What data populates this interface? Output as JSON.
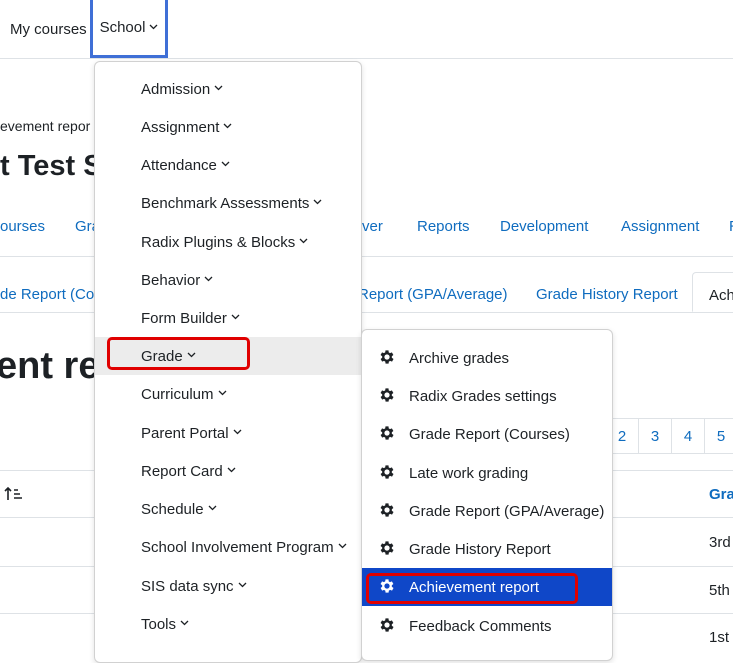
{
  "topnav": {
    "my_courses": "My courses",
    "school": "School"
  },
  "breadcrumb": "evement repor",
  "course_title": "t Test S",
  "secondary_nav": [
    "ourses",
    "Gra",
    "rver",
    "Reports",
    "Development",
    "Assignment",
    "R"
  ],
  "subtabs": [
    "de Report (Cou",
    "Report (GPA/Average)",
    "Grade History Report",
    "Ach"
  ],
  "page_heading": "ent rep",
  "pagination": [
    "2",
    "3",
    "4",
    "5"
  ],
  "table": {
    "sort_icon": "sort-ascending-icon",
    "header_right": "Gra",
    "cells": [
      "3rd",
      "5th",
      "1st"
    ]
  },
  "school_menu": {
    "items": [
      {
        "label": "Admission"
      },
      {
        "label": "Assignment"
      },
      {
        "label": "Attendance"
      },
      {
        "label": "Benchmark Assessments"
      },
      {
        "label": "Radix Plugins & Blocks"
      },
      {
        "label": "Behavior"
      },
      {
        "label": "Form Builder"
      },
      {
        "label": "Grade"
      },
      {
        "label": "Curriculum"
      },
      {
        "label": "Parent Portal"
      },
      {
        "label": "Report Card"
      },
      {
        "label": "Schedule"
      },
      {
        "label": "School Involvement Program"
      },
      {
        "label": "SIS data sync"
      },
      {
        "label": "Tools"
      }
    ]
  },
  "grade_submenu": {
    "icon": "gear-icon",
    "items": [
      {
        "label": "Archive grades"
      },
      {
        "label": "Radix Grades settings"
      },
      {
        "label": "Grade Report (Courses)"
      },
      {
        "label": "Late work grading"
      },
      {
        "label": "Grade Report (GPA/Average)"
      },
      {
        "label": "Grade History Report"
      },
      {
        "label": "Achievement report"
      },
      {
        "label": "Feedback Comments"
      }
    ]
  },
  "colors": {
    "link": "#0f6cbf",
    "active_item_bg": "#0f47c8",
    "highlight_border": "#e00000",
    "focus_border": "#3f6fd6"
  }
}
